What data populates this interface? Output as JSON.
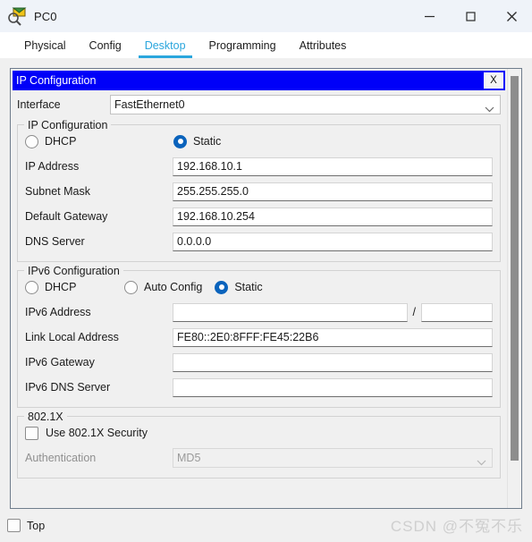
{
  "window": {
    "title": "PC0",
    "icon": "packet-tracer-icon",
    "controls": {
      "minimize": "minimize-icon",
      "maximize": "maximize-icon",
      "close": "close-icon"
    }
  },
  "tabs": [
    {
      "label": "Physical",
      "active": false
    },
    {
      "label": "Config",
      "active": false
    },
    {
      "label": "Desktop",
      "active": true
    },
    {
      "label": "Programming",
      "active": false
    },
    {
      "label": "Attributes",
      "active": false
    }
  ],
  "colors": {
    "tab_active": "#2ba6dd",
    "titlebar_blue": "#0000f8",
    "radio_selected": "#0a63bc",
    "window_chrome": "#eff3f9",
    "panel_bg": "#f0f0f0",
    "watermark": "#cfcfcf"
  },
  "ip_config_window": {
    "header_title": "IP Configuration",
    "close_label": "X",
    "interface": {
      "label": "Interface",
      "value": "FastEthernet0",
      "chevron": "chevron-down-icon"
    },
    "ipv4": {
      "legend": "IP Configuration",
      "modes": [
        {
          "label": "DHCP",
          "selected": false
        },
        {
          "label": "Static",
          "selected": true
        }
      ],
      "fields": [
        {
          "label": "IP Address",
          "value": "192.168.10.1",
          "placeholder": ""
        },
        {
          "label": "Subnet Mask",
          "value": "255.255.255.0",
          "placeholder": ""
        },
        {
          "label": "Default Gateway",
          "value": "192.168.10.254",
          "placeholder": ""
        },
        {
          "label": "DNS Server",
          "value": "0.0.0.0",
          "placeholder": ""
        }
      ]
    },
    "ipv6": {
      "legend": "IPv6 Configuration",
      "modes": [
        {
          "label": "DHCP",
          "selected": false
        },
        {
          "label": "Auto Config",
          "selected": false
        },
        {
          "label": "Static",
          "selected": true
        }
      ],
      "address": {
        "label": "IPv6 Address",
        "value": "",
        "separator": "/",
        "prefix_value": ""
      },
      "fields": [
        {
          "label": "Link Local Address",
          "value": "FE80::2E0:8FFF:FE45:22B6"
        },
        {
          "label": "IPv6 Gateway",
          "value": ""
        },
        {
          "label": "IPv6 DNS Server",
          "value": ""
        }
      ]
    },
    "dot1x": {
      "legend": "802.1X",
      "checkbox_label": "Use 802.1X Security",
      "checkbox_checked": false,
      "authentication": {
        "label": "Authentication",
        "value": "MD5",
        "disabled": true
      }
    }
  },
  "bottom": {
    "top_checkbox_label": "Top",
    "top_checkbox_checked": false,
    "watermark": "CSDN @不冤不乐"
  }
}
